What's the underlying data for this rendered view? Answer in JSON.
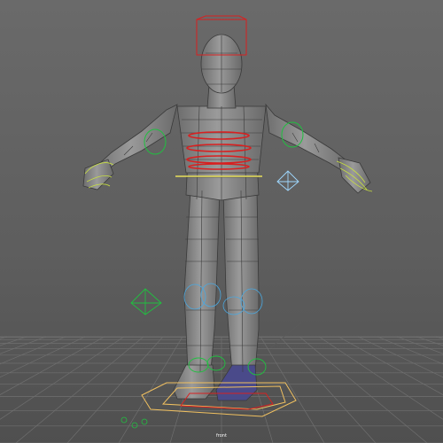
{
  "viewport": {
    "camera_label": "front",
    "background_top": "#6a6a6a",
    "background_bottom": "#4f4f4f"
  },
  "scene": {
    "mesh_color": "#8c8c8c",
    "wire_color": "#3a3a3a",
    "controls": {
      "hip_control_color": "#e8e05a",
      "spine_control_color": "#d82020",
      "head_control_color": "#d82020",
      "ik_control_color": "#20c040",
      "pole_vector_color": "#9fd8ff",
      "finger_control_color": "#c8e040",
      "foot_control_color": "#f0c060"
    }
  }
}
